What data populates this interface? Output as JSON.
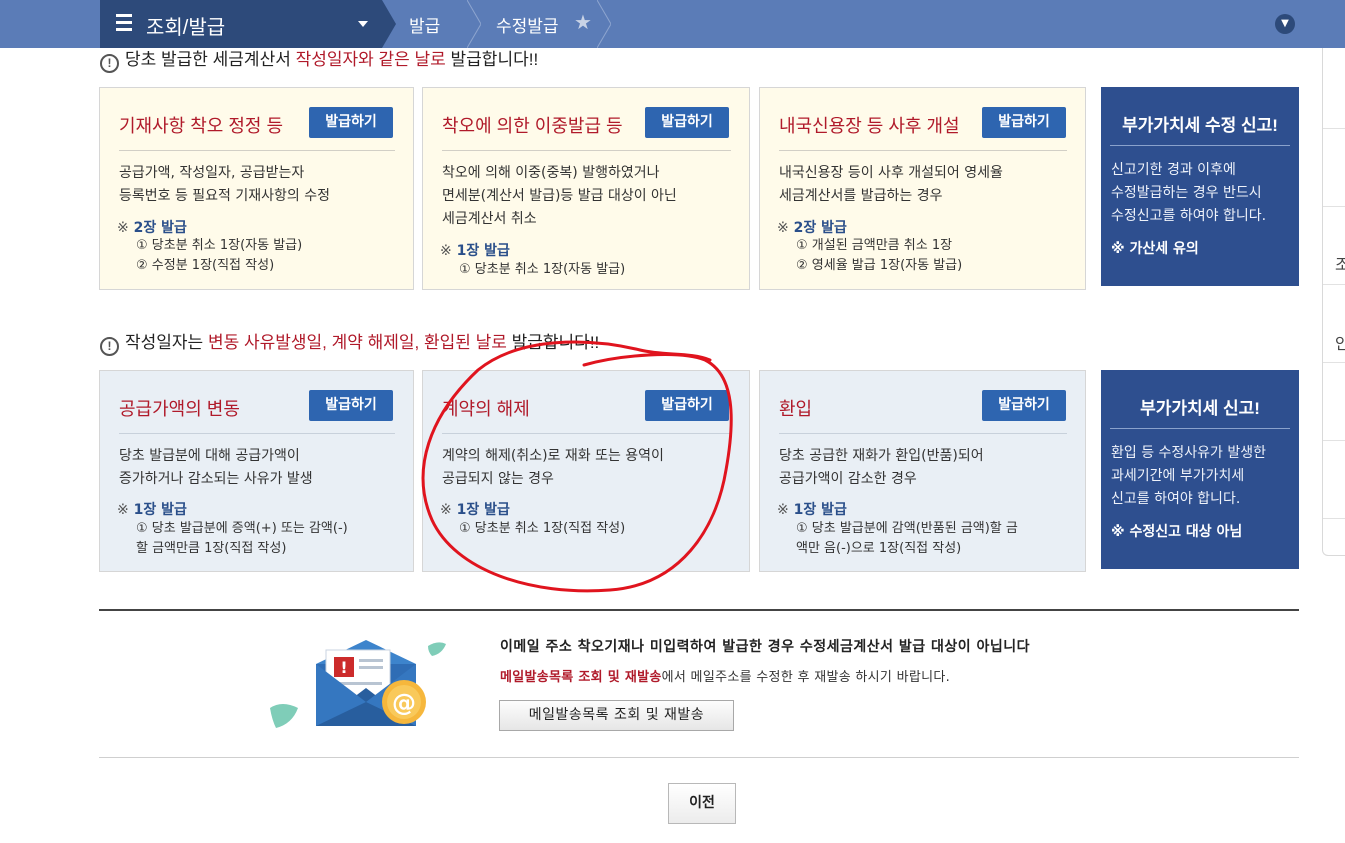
{
  "nav": {
    "menu_title": "조회/발급",
    "crumb1": "발급",
    "crumb2": "수정발급"
  },
  "right_strip": {
    "chars": [
      "조",
      "안"
    ]
  },
  "notice1": {
    "pre": "당초 발급한 세금계산서 ",
    "red": "작성일자와 같은 날로",
    "post": " 발급합니다!!"
  },
  "notice2": {
    "pre": "작성일자는 ",
    "red": "변동 사유발생일, 계약 해제일, 환입된 날로",
    "post": " 발급합니다!!"
  },
  "section1": {
    "cards": [
      {
        "title": "기재사항 착오 정정 등",
        "button": "발급하기",
        "desc": [
          "공급가액, 작성일자, 공급받는자",
          "등록번호 등 필요적 기재사항의 수정"
        ],
        "count": "2장 발급",
        "subs": [
          "① 당초분 취소 1장(자동 발급)",
          "② 수정분 1장(직접 작성)"
        ]
      },
      {
        "title": "착오에 의한 이중발급 등",
        "button": "발급하기",
        "desc": [
          "착오에 의해 이중(중복) 발행하였거나",
          "면세분(계산서 발급)등 발급 대상이 아닌",
          "세금계산서 취소"
        ],
        "count": "1장 발급",
        "subs": [
          "① 당초분 취소 1장(자동 발급)"
        ]
      },
      {
        "title": "내국신용장 등 사후 개설",
        "button": "발급하기",
        "desc": [
          "내국신용장 등이 사후 개설되어 영세율",
          "세금계산서를 발급하는 경우"
        ],
        "count": "2장 발급",
        "subs": [
          "① 개설된 금액만큼 취소 1장",
          "② 영세율 발급 1장(자동 발급)"
        ]
      }
    ],
    "blue": {
      "title": "부가가치세 수정 신고!",
      "desc": [
        "신고기한 경과 이후에",
        "수정발급하는 경우 반드시",
        "수정신고를 하여야 합니다."
      ],
      "warn": "※ 가산세 유의"
    }
  },
  "section2": {
    "cards": [
      {
        "title": "공급가액의 변동",
        "button": "발급하기",
        "desc": [
          "당초 발급분에 대해 공급가액이",
          "증가하거나 감소되는 사유가 발생"
        ],
        "count": "1장 발급",
        "subs": [
          "① 당초 발급분에 증액(+) 또는 감액(-)",
          "할 금액만큼 1장(직접 작성)"
        ]
      },
      {
        "title": "계약의 해제",
        "button": "발급하기",
        "desc": [
          "계약의 해제(취소)로 재화 또는 용역이",
          "공급되지 않는 경우"
        ],
        "count": "1장 발급",
        "subs": [
          "① 당초분 취소 1장(직접 작성)"
        ]
      },
      {
        "title": "환입",
        "button": "발급하기",
        "desc": [
          "당초 공급한 재화가 환입(반품)되어",
          "공급가액이 감소한 경우"
        ],
        "count": "1장 발급",
        "subs": [
          "① 당초 발급분에 감액(반품된 금액)할 금",
          "액만 음(-)으로 1장(직접 작성)"
        ]
      }
    ],
    "blue": {
      "title": "부가가치세 신고!",
      "desc": [
        "환입 등 수정사유가 발생한",
        "과세기간에 부가가치세",
        "신고를 하여야 합니다."
      ],
      "warn": "※ 수정신고 대상 아님"
    }
  },
  "mail": {
    "headline": "이메일 주소 착오기재나 미입력하여 발급한 경우 수정세금계산서 발급 대상이 아닙니다",
    "link_text": "메일발송목록 조회 및 재발송",
    "rest_text": "에서 메일주소를 수정한 후 재발송 하시기 바랍니다.",
    "button": "메일발송목록 조회 및 재발송"
  },
  "prev_button": "이전",
  "count_mark": "※",
  "colors": {
    "nav": "#5b7cb7",
    "nav_dark": "#2d4a7a",
    "accent_red": "#b01a2a",
    "button_blue": "#2e65b0",
    "blue_box": "#2e4f8f",
    "annotation": "#e0141e"
  }
}
